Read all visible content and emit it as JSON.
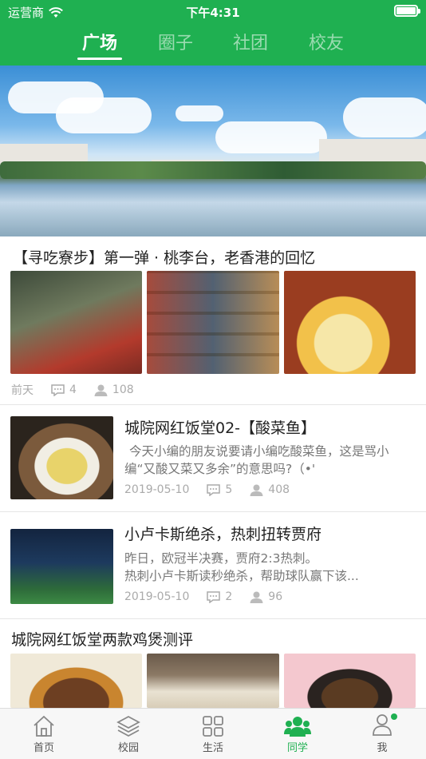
{
  "status_bar": {
    "carrier": "运营商",
    "time": "下午4:31"
  },
  "tabs": [
    {
      "label": "广场",
      "active": true
    },
    {
      "label": "圈子",
      "active": false
    },
    {
      "label": "社团",
      "active": false
    },
    {
      "label": "校友",
      "active": false
    }
  ],
  "articles": [
    {
      "title": "【寻吃寮步】第一弹 · 桃李台，老香港的回忆",
      "date": "前天",
      "comments": "4",
      "views": "108"
    },
    {
      "title": "城院网红饭堂02-【酸菜鱼】",
      "excerpt": "今天小编的朋友说要请小编吃酸菜鱼，这是骂小编“又酸又菜又多余”的意思吗?（•'",
      "date": "2019-05-10",
      "comments": "5",
      "views": "408"
    },
    {
      "title": "小卢卡斯绝杀，热刺扭转贾府",
      "excerpt_line1": "昨日，欧冠半决赛，贾府2:3热刺。",
      "excerpt_line2": "热刺小卢卡斯读秒绝杀，帮助球队赢下该...",
      "date": "2019-05-10",
      "comments": "2",
      "views": "96"
    },
    {
      "title": "城院网红饭堂两款鸡煲测评"
    }
  ],
  "bottom_nav": [
    {
      "label": "首页",
      "icon": "home-icon",
      "active": false
    },
    {
      "label": "校园",
      "icon": "layers-icon",
      "active": false
    },
    {
      "label": "生活",
      "icon": "grid-icon",
      "active": false
    },
    {
      "label": "同学",
      "icon": "classmates-icon",
      "active": true
    },
    {
      "label": "我",
      "icon": "person-icon",
      "active": false,
      "badge": true
    }
  ],
  "colors": {
    "brand": "#1fb051",
    "meta": "#aaaaaa",
    "divider": "#e6e6e6"
  }
}
